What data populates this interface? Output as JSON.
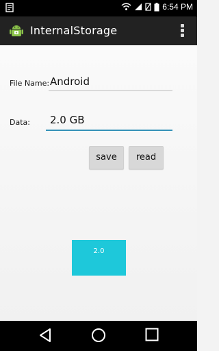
{
  "status_bar": {
    "time": "6:54 PM",
    "icons": [
      "notification-icon",
      "wifi-icon",
      "signal-icon",
      "no-sim-icon",
      "battery-icon"
    ]
  },
  "action_bar": {
    "title": "InternalStorage",
    "icons": [
      "android-icon",
      "overflow-menu-icon"
    ]
  },
  "form": {
    "file_name_label": "File Name:",
    "file_name_value": "Android",
    "data_label": "Data:",
    "data_value": "2.0 GB"
  },
  "buttons": {
    "save": "save",
    "read": "read"
  },
  "display": {
    "value": "2.0"
  },
  "nav_bar": {
    "icons": [
      "back-icon",
      "home-icon",
      "recents-icon"
    ]
  },
  "colors": {
    "accent": "#1ec8da",
    "input_focus": "#3591b8",
    "app_icon": "#8bc34a"
  }
}
